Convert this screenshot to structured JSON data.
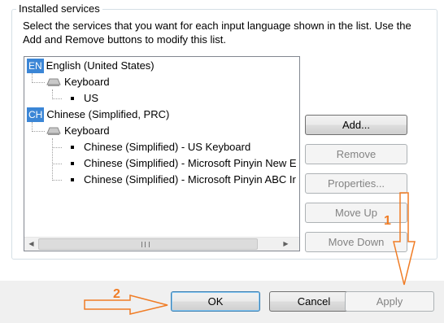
{
  "group": {
    "title": "Installed services",
    "instructions": "Select the services that you want for each input language shown in the list. Use the Add and Remove buttons to modify this list."
  },
  "tree": {
    "languages": [
      {
        "badge": "EN",
        "name": "English (United States)",
        "category": "Keyboard",
        "services": [
          "US"
        ]
      },
      {
        "badge": "CH",
        "name": "Chinese (Simplified, PRC)",
        "category": "Keyboard",
        "services": [
          "Chinese (Simplified) - US Keyboard",
          "Chinese (Simplified) - Microsoft Pinyin New E",
          "Chinese (Simplified) - Microsoft Pinyin ABC Ir"
        ]
      }
    ],
    "badge_color": "#3b86d6"
  },
  "side_buttons": {
    "add": "Add...",
    "remove": "Remove",
    "properties": "Properties...",
    "move_up": "Move Up",
    "move_down": "Move Down"
  },
  "footer": {
    "ok": "OK",
    "cancel": "Cancel",
    "apply": "Apply"
  },
  "annotations": {
    "step1": "1",
    "step2": "2",
    "color": "#f07c25"
  },
  "icons": {
    "keyboard": "keyboard-icon",
    "scroll_left": "scroll-left-arrow-icon",
    "scroll_right": "scroll-right-arrow-icon",
    "scroll_grip": "scroll-grip-icon"
  }
}
